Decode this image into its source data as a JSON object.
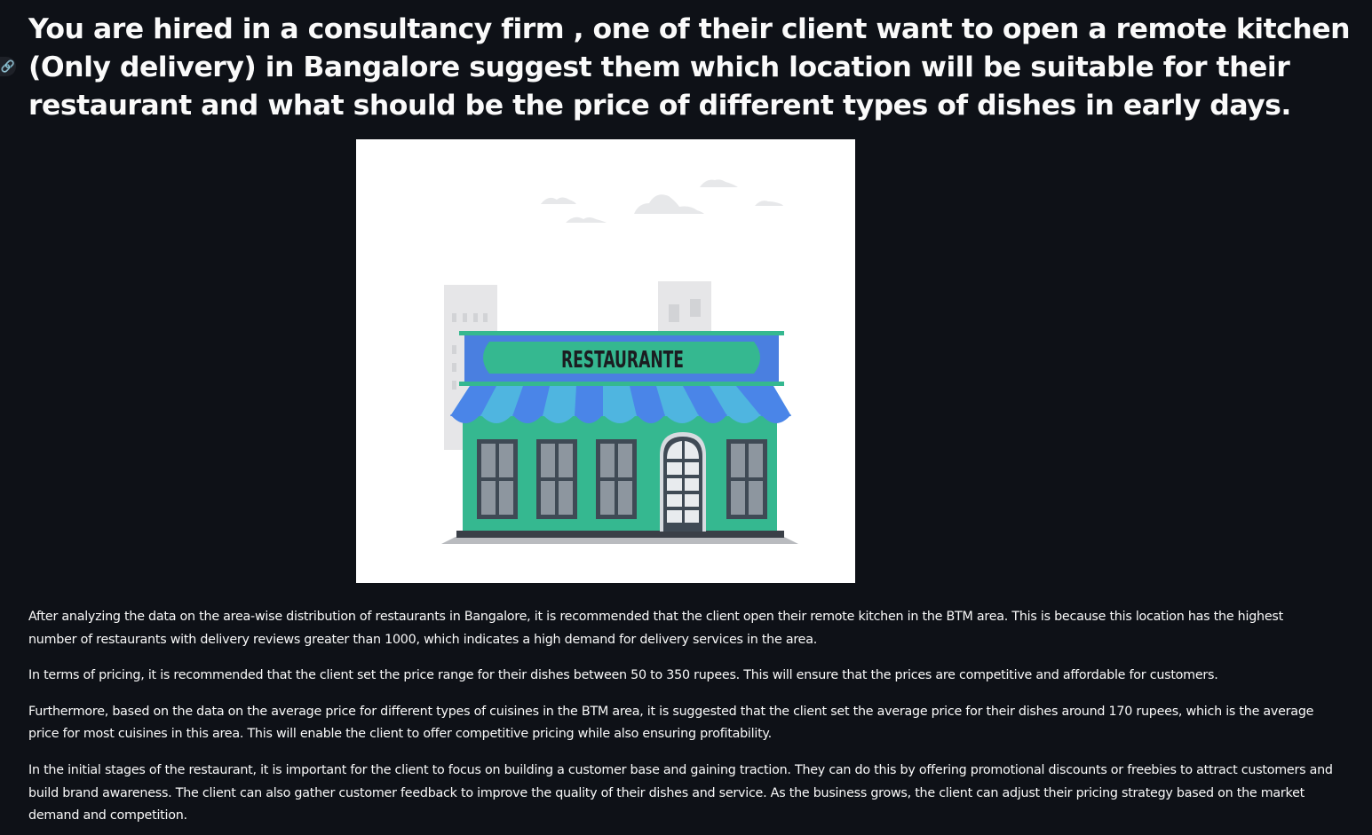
{
  "icons": {
    "anchor": "link-icon"
  },
  "colors": {
    "background": "#0e1117",
    "text": "#fafafa",
    "shop_green": "#35b890",
    "awning_blue": "#4a85e8",
    "awning_cyan": "#4fb5e0"
  },
  "header": {
    "title": "You are hired in a consultancy firm , one of their client want to open a remote kitchen (Only delivery) in Bangalore suggest them which location will be suitable for their restaurant and what should be the price of different types of dishes in early days."
  },
  "illustration": {
    "sign_text": "RESTAURANTE"
  },
  "content": {
    "paragraphs": [
      "After analyzing the data on the area-wise distribution of restaurants in Bangalore, it is recommended that the client open their remote kitchen in the BTM area. This is because this location has the highest number of restaurants with delivery reviews greater than 1000, which indicates a high demand for delivery services in the area.",
      "In terms of pricing, it is recommended that the client set the price range for their dishes between 50 to 350 rupees. This will ensure that the prices are competitive and affordable for customers.",
      "Furthermore, based on the data on the average price for different types of cuisines in the BTM area, it is suggested that the client set the average price for their dishes around 170 rupees, which is the average price for most cuisines in this area. This will enable the client to offer competitive pricing while also ensuring profitability.",
      "In the initial stages of the restaurant, it is important for the client to focus on building a customer base and gaining traction. They can do this by offering promotional discounts or freebies to attract customers and build brand awareness. The client can also gather customer feedback to improve the quality of their dishes and service. As the business grows, the client can adjust their pricing strategy based on the market demand and competition."
    ]
  }
}
